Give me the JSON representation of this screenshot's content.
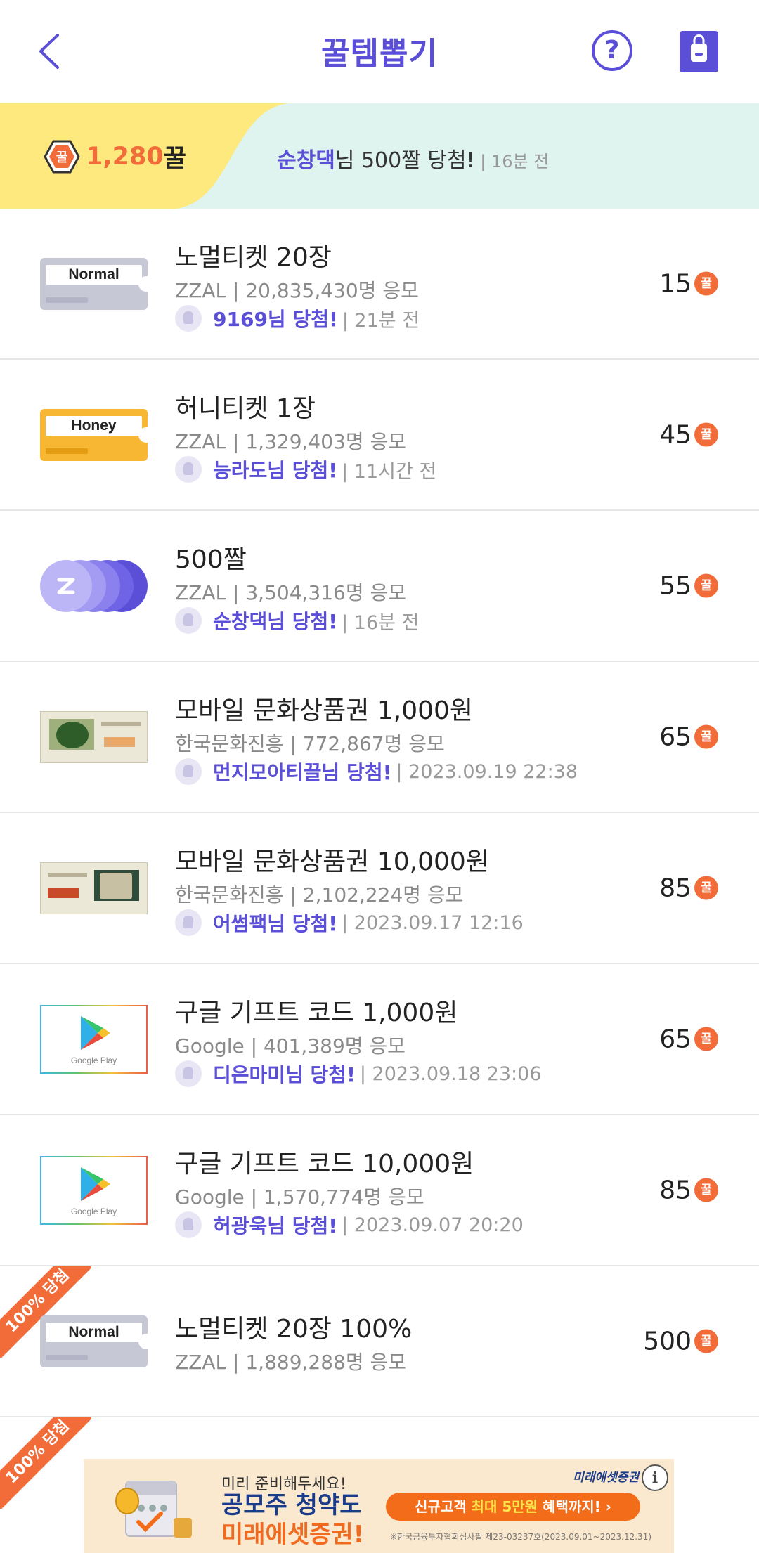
{
  "header": {
    "title": "꿀템뽑기",
    "help_label": "?"
  },
  "banner": {
    "honey_icon_label": "꿀",
    "balance": "1,280",
    "balance_unit": "꿀",
    "ticker_name": "순창댁",
    "ticker_text": "님 500짤 당첨!",
    "ticker_sep": " | ",
    "ticker_time": "16분 전"
  },
  "coin_label": "꿀",
  "items": [
    {
      "thumb": "normal-ticket",
      "thumb_label": "Normal",
      "title": "노멀티켓 20장",
      "meta": "ZZAL | 20,835,430명 응모",
      "winner": "9169님 당첨!",
      "time": "21분 전",
      "price": "15"
    },
    {
      "thumb": "honey-ticket",
      "thumb_label": "Honey",
      "title": "허니티켓 1장",
      "meta": "ZZAL | 1,329,403명 응모",
      "winner": "능라도님 당첨!",
      "time": "11시간 전",
      "price": "45"
    },
    {
      "thumb": "zzal-coins",
      "title": "500짤",
      "meta": "ZZAL | 3,504,316명 응모",
      "winner": "순창댁님 당첨!",
      "time": "16분 전",
      "price": "55"
    },
    {
      "thumb": "culture-voucher",
      "title": "모바일 문화상품권 1,000원",
      "meta": "한국문화진흥 | 772,867명 응모",
      "winner": "먼지모아티끌님 당첨!",
      "time": "2023.09.19 22:38",
      "price": "65"
    },
    {
      "thumb": "culture-voucher",
      "title": "모바일 문화상품권 10,000원",
      "meta": "한국문화진흥 | 2,102,224명 응모",
      "winner": "어썸팩님 당첨!",
      "time": "2023.09.17 12:16",
      "price": "85"
    },
    {
      "thumb": "google-play",
      "thumb_label": "Google Play",
      "title": "구글 기프트 코드 1,000원",
      "meta": "Google | 401,389명 응모",
      "winner": "디은마미님 당첨!",
      "time": "2023.09.18 23:06",
      "price": "65"
    },
    {
      "thumb": "google-play",
      "thumb_label": "Google Play",
      "title": "구글 기프트 코드 10,000원",
      "meta": "Google | 1,570,774명 응모",
      "winner": "허광욱님 당첨!",
      "time": "2023.09.07 20:20",
      "price": "85"
    },
    {
      "thumb": "normal-ticket",
      "thumb_label": "Normal",
      "ribbon": "100% 당첨",
      "title": "노멀티켓 20장 100%",
      "meta": "ZZAL | 1,889,288명 응모",
      "price": "500"
    }
  ],
  "partial_ribbon": "100% 당첨",
  "ad": {
    "pre": "미리 준비해두세요!",
    "head1": "공모주 청약도",
    "head2": "미래에셋증권!",
    "brand": "미래에셋증권",
    "cta_pre": "신규고객 ",
    "cta_hl": "최대 5만원",
    "cta_post": " 혜택까지! ›",
    "fine": "※한국금융투자협회심사필 제23-03237호(2023.09.01~2023.12.31)",
    "info": "i"
  },
  "colors": {
    "accent": "#5b4fd8",
    "honey": "#f26c3a",
    "banner_yellow": "#fde97e",
    "banner_mint": "#dff3ef"
  }
}
